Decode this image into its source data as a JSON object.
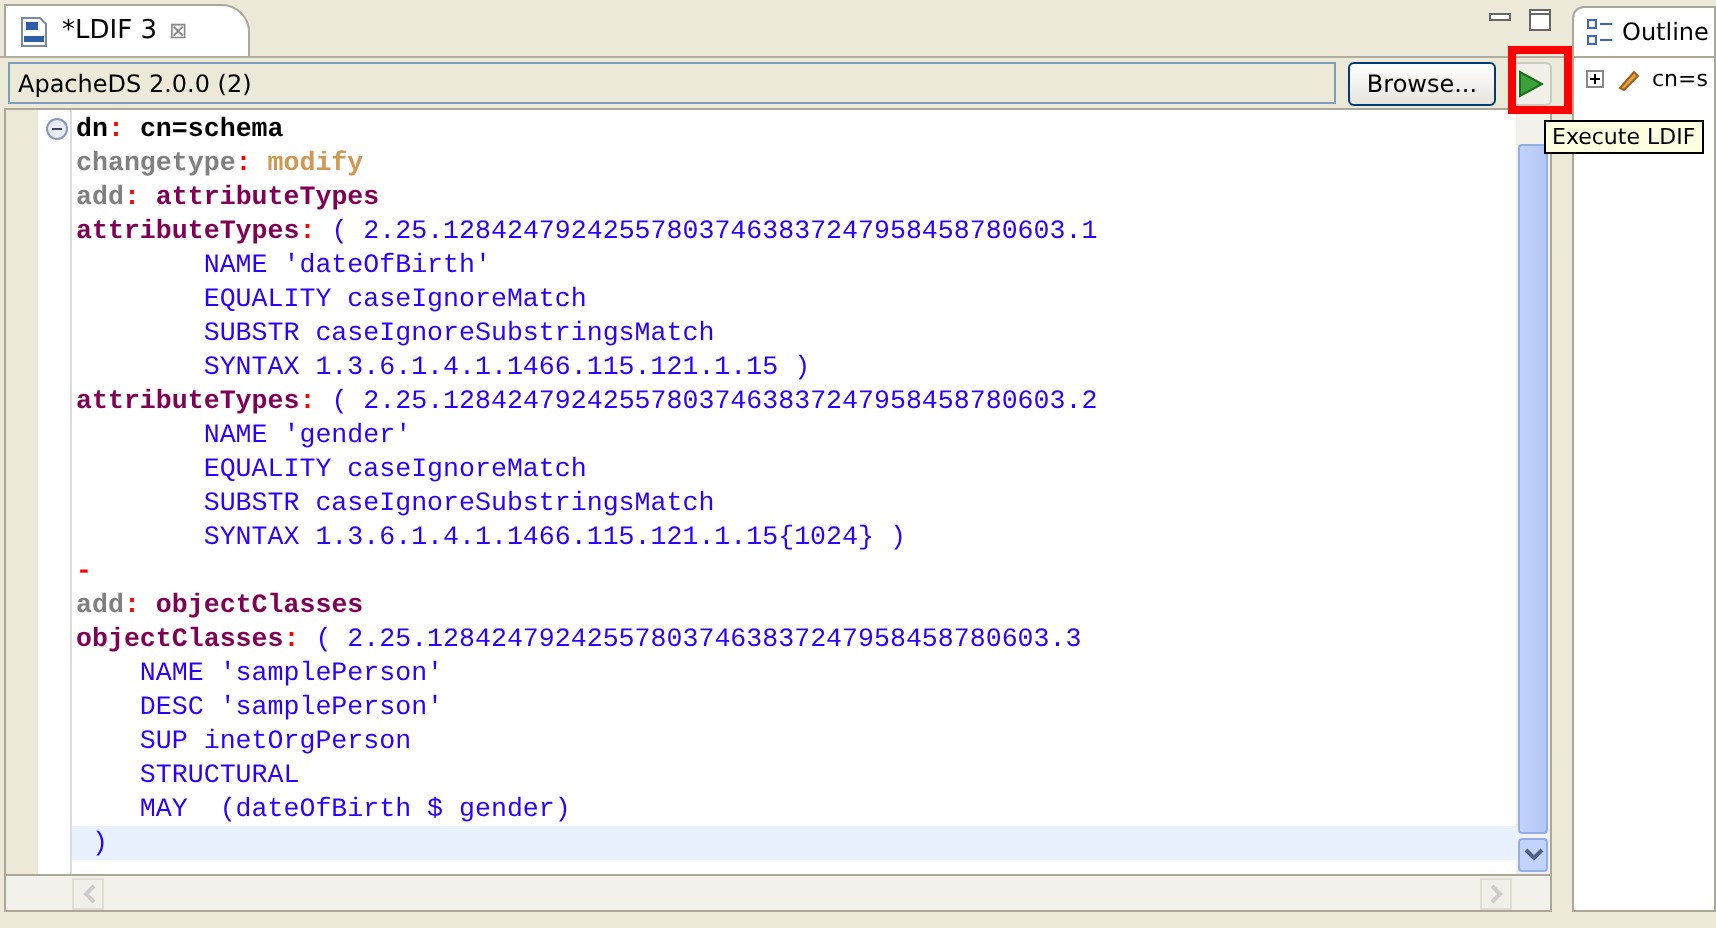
{
  "editor_tab": {
    "title": "*LDIF 3",
    "close": "⊠"
  },
  "connection": {
    "value": "ApacheDS 2.0.0 (2)"
  },
  "browse_button": "Browse...",
  "run_button": {
    "highlighted": true,
    "tooltip": "Execute LDIF"
  },
  "lines": [
    {
      "current": false,
      "expanded": true,
      "segments": [
        {
          "kind": "dn",
          "text": "dn"
        },
        {
          "kind": "sep",
          "text": ": "
        },
        {
          "kind": "dn",
          "text": "cn=schema"
        }
      ]
    },
    {
      "current": false,
      "segments": [
        {
          "kind": "gray",
          "text": "changetype"
        },
        {
          "kind": "sep",
          "text": ": "
        },
        {
          "kind": "mod",
          "text": "modify"
        }
      ]
    },
    {
      "current": false,
      "segments": [
        {
          "kind": "gray",
          "text": "add"
        },
        {
          "kind": "sep",
          "text": ": "
        },
        {
          "kind": "attr",
          "text": "attributeTypes"
        }
      ]
    },
    {
      "current": false,
      "segments": [
        {
          "kind": "attr",
          "text": "attributeTypes"
        },
        {
          "kind": "sep",
          "text": ": "
        },
        {
          "kind": "value",
          "text": "( 2.25.128424792425578037463837247958458780603.1"
        }
      ]
    },
    {
      "current": false,
      "segments": [
        {
          "kind": "value",
          "text": "        NAME 'dateOfBirth'"
        }
      ]
    },
    {
      "current": false,
      "segments": [
        {
          "kind": "value",
          "text": "        EQUALITY caseIgnoreMatch"
        }
      ]
    },
    {
      "current": false,
      "segments": [
        {
          "kind": "value",
          "text": "        SUBSTR caseIgnoreSubstringsMatch"
        }
      ]
    },
    {
      "current": false,
      "segments": [
        {
          "kind": "value",
          "text": "        SYNTAX 1.3.6.1.4.1.1466.115.121.1.15 )"
        }
      ]
    },
    {
      "current": false,
      "segments": [
        {
          "kind": "attr",
          "text": "attributeTypes"
        },
        {
          "kind": "sep",
          "text": ": "
        },
        {
          "kind": "value",
          "text": "( 2.25.128424792425578037463837247958458780603.2"
        }
      ]
    },
    {
      "current": false,
      "segments": [
        {
          "kind": "value",
          "text": "        NAME 'gender'"
        }
      ]
    },
    {
      "current": false,
      "segments": [
        {
          "kind": "value",
          "text": "        EQUALITY caseIgnoreMatch"
        }
      ]
    },
    {
      "current": false,
      "segments": [
        {
          "kind": "value",
          "text": "        SUBSTR caseIgnoreSubstringsMatch"
        }
      ]
    },
    {
      "current": false,
      "segments": [
        {
          "kind": "value",
          "text": "        SYNTAX 1.3.6.1.4.1.1466.115.121.1.15{1024} )"
        }
      ]
    },
    {
      "current": false,
      "segments": [
        {
          "kind": "sep",
          "text": "-"
        }
      ]
    },
    {
      "current": false,
      "segments": [
        {
          "kind": "gray",
          "text": "add"
        },
        {
          "kind": "sep",
          "text": ": "
        },
        {
          "kind": "attr",
          "text": "objectClasses"
        }
      ]
    },
    {
      "current": false,
      "segments": [
        {
          "kind": "attr",
          "text": "objectClasses"
        },
        {
          "kind": "sep",
          "text": ": "
        },
        {
          "kind": "value",
          "text": "( 2.25.128424792425578037463837247958458780603.3"
        }
      ]
    },
    {
      "current": false,
      "segments": [
        {
          "kind": "value",
          "text": "    NAME 'samplePerson'"
        }
      ]
    },
    {
      "current": false,
      "segments": [
        {
          "kind": "value",
          "text": "    DESC 'samplePerson'"
        }
      ]
    },
    {
      "current": false,
      "segments": [
        {
          "kind": "value",
          "text": "    SUP inetOrgPerson"
        }
      ]
    },
    {
      "current": false,
      "segments": [
        {
          "kind": "value",
          "text": "    STRUCTURAL"
        }
      ]
    },
    {
      "current": false,
      "segments": [
        {
          "kind": "value",
          "text": "    MAY  (dateOfBirth $ gender)"
        }
      ]
    },
    {
      "current": true,
      "segments": [
        {
          "kind": "value",
          "text": " )"
        }
      ]
    }
  ],
  "outline": {
    "title": "Outline",
    "items": [
      {
        "label": "cn=s",
        "expanded": false
      }
    ]
  }
}
